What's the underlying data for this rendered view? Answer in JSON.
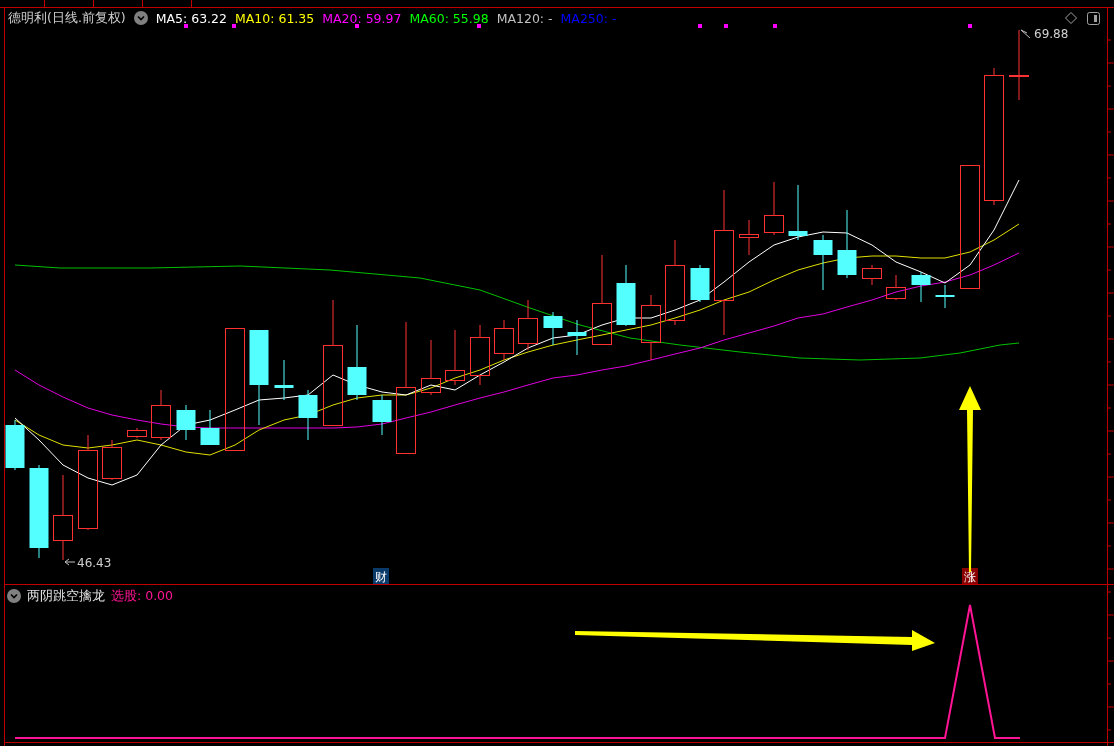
{
  "header": {
    "title": "德明利(日线.前复权)",
    "indicators": [
      {
        "label": "MA5: 63.22",
        "color": "#ffffff"
      },
      {
        "label": "MA10: 61.35",
        "color": "#ffff00"
      },
      {
        "label": "MA20: 59.97",
        "color": "#ff00ff"
      },
      {
        "label": "MA60: 55.98",
        "color": "#00ff00"
      },
      {
        "label": "MA120: -",
        "color": "#c0c0c0"
      },
      {
        "label": "MA250: -",
        "color": "#0000ff"
      }
    ]
  },
  "chart": {
    "high_label": "69.88",
    "low_label": "46.43",
    "markers": [
      {
        "kind": "finance",
        "label": "财"
      },
      {
        "kind": "limit-up",
        "label": "涨"
      }
    ]
  },
  "sub_panel": {
    "title": "两阴跳空擒龙",
    "indicator": "选股: 0.00"
  }
}
